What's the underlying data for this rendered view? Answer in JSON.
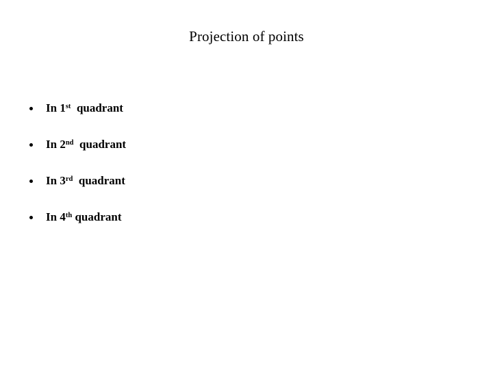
{
  "slide": {
    "background_color": "#ffffff",
    "text_color": "#000000",
    "title": "Projection of points",
    "bullets": [
      {
        "full_text": "In 1st  quadrant",
        "prefix": "In 1",
        "ordinal_suffix": "st",
        "trailing": "  quadrant",
        "bullet_glyph": "bullet-dot"
      },
      {
        "full_text": "In 2nd  quadrant",
        "prefix": "In 2",
        "ordinal_suffix": "nd",
        "trailing": "  quadrant",
        "bullet_glyph": "bullet-dot"
      },
      {
        "full_text": "In 3rd  quadrant",
        "prefix": "In 3",
        "ordinal_suffix": "rd",
        "trailing": "  quadrant",
        "bullet_glyph": "bullet-dot"
      },
      {
        "full_text": "In 4th quadrant",
        "prefix": "In 4",
        "ordinal_suffix": "th",
        "trailing": " quadrant",
        "bullet_glyph": "bullet-dot"
      }
    ]
  }
}
